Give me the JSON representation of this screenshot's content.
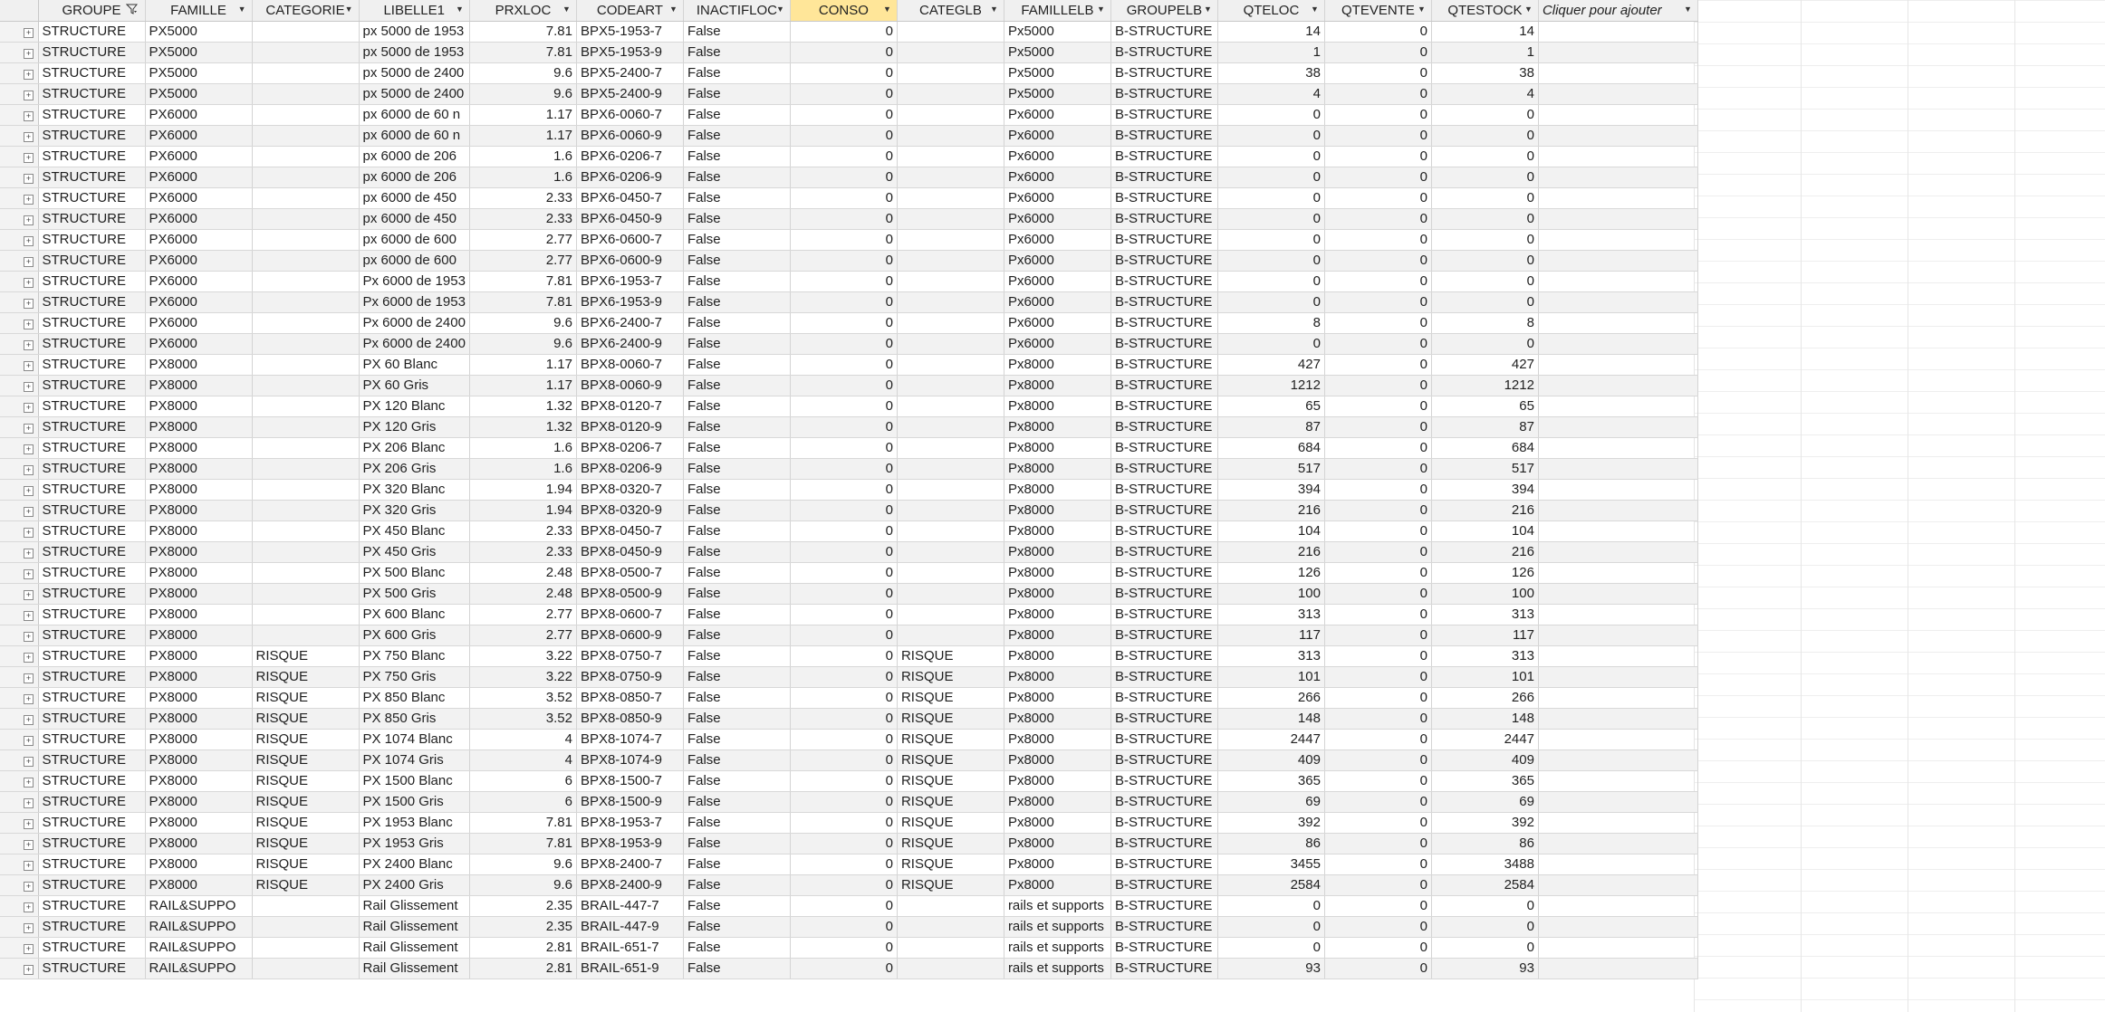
{
  "columns": [
    {
      "key": "GROUPE",
      "label": "GROUPE",
      "icon": "filter-dropdown-icon"
    },
    {
      "key": "FAMILLE",
      "label": "FAMILLE",
      "icon": "dropdown-arrow-icon"
    },
    {
      "key": "CATEGORIE",
      "label": "CATEGORIE",
      "icon": "dropdown-arrow-icon"
    },
    {
      "key": "LIBELLE1",
      "label": "LIBELLE1",
      "icon": "dropdown-arrow-icon"
    },
    {
      "key": "PRXLOC",
      "label": "PRXLOC",
      "icon": "dropdown-arrow-icon"
    },
    {
      "key": "CODEART",
      "label": "CODEART",
      "icon": "dropdown-arrow-icon"
    },
    {
      "key": "INACTIFLOC",
      "label": "INACTIFLOC",
      "icon": "dropdown-arrow-icon"
    },
    {
      "key": "CONSO",
      "label": "CONSO",
      "icon": "dropdown-arrow-icon",
      "active": true
    },
    {
      "key": "CATEGLB",
      "label": "CATEGLB",
      "icon": "dropdown-arrow-icon"
    },
    {
      "key": "FAMILLELB",
      "label": "FAMILLELB",
      "icon": "dropdown-arrow-icon"
    },
    {
      "key": "GROUPELB",
      "label": "GROUPELB",
      "icon": "dropdown-arrow-icon"
    },
    {
      "key": "QTELOC",
      "label": "QTELOC",
      "icon": "dropdown-arrow-icon"
    },
    {
      "key": "QTEVENTE",
      "label": "QTEVENTE",
      "icon": "dropdown-arrow-icon"
    },
    {
      "key": "QTESTOCK",
      "label": "QTESTOCK",
      "icon": "dropdown-arrow-icon"
    },
    {
      "key": "ADD",
      "label": "Cliquer pour ajouter",
      "icon": "dropdown-arrow-icon"
    }
  ],
  "rows": [
    [
      "STRUCTURE",
      "PX5000",
      "",
      "px 5000 de 1953",
      "7.81",
      "BPX5-1953-7",
      "False",
      "0",
      "",
      "Px5000",
      "B-STRUCTURE",
      "14",
      "0",
      "14"
    ],
    [
      "STRUCTURE",
      "PX5000",
      "",
      "px 5000 de 1953",
      "7.81",
      "BPX5-1953-9",
      "False",
      "0",
      "",
      "Px5000",
      "B-STRUCTURE",
      "1",
      "0",
      "1"
    ],
    [
      "STRUCTURE",
      "PX5000",
      "",
      "px 5000 de 2400",
      "9.6",
      "BPX5-2400-7",
      "False",
      "0",
      "",
      "Px5000",
      "B-STRUCTURE",
      "38",
      "0",
      "38"
    ],
    [
      "STRUCTURE",
      "PX5000",
      "",
      "px 5000 de 2400",
      "9.6",
      "BPX5-2400-9",
      "False",
      "0",
      "",
      "Px5000",
      "B-STRUCTURE",
      "4",
      "0",
      "4"
    ],
    [
      "STRUCTURE",
      "PX6000",
      "",
      "px 6000 de 60 n",
      "1.17",
      "BPX6-0060-7",
      "False",
      "0",
      "",
      "Px6000",
      "B-STRUCTURE",
      "0",
      "0",
      "0"
    ],
    [
      "STRUCTURE",
      "PX6000",
      "",
      "px 6000 de 60 n",
      "1.17",
      "BPX6-0060-9",
      "False",
      "0",
      "",
      "Px6000",
      "B-STRUCTURE",
      "0",
      "0",
      "0"
    ],
    [
      "STRUCTURE",
      "PX6000",
      "",
      "px 6000 de 206",
      "1.6",
      "BPX6-0206-7",
      "False",
      "0",
      "",
      "Px6000",
      "B-STRUCTURE",
      "0",
      "0",
      "0"
    ],
    [
      "STRUCTURE",
      "PX6000",
      "",
      "px 6000 de 206",
      "1.6",
      "BPX6-0206-9",
      "False",
      "0",
      "",
      "Px6000",
      "B-STRUCTURE",
      "0",
      "0",
      "0"
    ],
    [
      "STRUCTURE",
      "PX6000",
      "",
      "px 6000 de 450",
      "2.33",
      "BPX6-0450-7",
      "False",
      "0",
      "",
      "Px6000",
      "B-STRUCTURE",
      "0",
      "0",
      "0"
    ],
    [
      "STRUCTURE",
      "PX6000",
      "",
      "px 6000 de 450",
      "2.33",
      "BPX6-0450-9",
      "False",
      "0",
      "",
      "Px6000",
      "B-STRUCTURE",
      "0",
      "0",
      "0"
    ],
    [
      "STRUCTURE",
      "PX6000",
      "",
      "px 6000 de 600",
      "2.77",
      "BPX6-0600-7",
      "False",
      "0",
      "",
      "Px6000",
      "B-STRUCTURE",
      "0",
      "0",
      "0"
    ],
    [
      "STRUCTURE",
      "PX6000",
      "",
      "px 6000 de 600",
      "2.77",
      "BPX6-0600-9",
      "False",
      "0",
      "",
      "Px6000",
      "B-STRUCTURE",
      "0",
      "0",
      "0"
    ],
    [
      "STRUCTURE",
      "PX6000",
      "",
      "Px 6000 de 1953",
      "7.81",
      "BPX6-1953-7",
      "False",
      "0",
      "",
      "Px6000",
      "B-STRUCTURE",
      "0",
      "0",
      "0"
    ],
    [
      "STRUCTURE",
      "PX6000",
      "",
      "Px 6000 de 1953",
      "7.81",
      "BPX6-1953-9",
      "False",
      "0",
      "",
      "Px6000",
      "B-STRUCTURE",
      "0",
      "0",
      "0"
    ],
    [
      "STRUCTURE",
      "PX6000",
      "",
      "Px 6000 de 2400",
      "9.6",
      "BPX6-2400-7",
      "False",
      "0",
      "",
      "Px6000",
      "B-STRUCTURE",
      "8",
      "0",
      "8"
    ],
    [
      "STRUCTURE",
      "PX6000",
      "",
      "Px 6000 de 2400",
      "9.6",
      "BPX6-2400-9",
      "False",
      "0",
      "",
      "Px6000",
      "B-STRUCTURE",
      "0",
      "0",
      "0"
    ],
    [
      "STRUCTURE",
      "PX8000",
      "",
      "PX 60 Blanc",
      "1.17",
      "BPX8-0060-7",
      "False",
      "0",
      "",
      "Px8000",
      "B-STRUCTURE",
      "427",
      "0",
      "427"
    ],
    [
      "STRUCTURE",
      "PX8000",
      "",
      "PX 60 Gris",
      "1.17",
      "BPX8-0060-9",
      "False",
      "0",
      "",
      "Px8000",
      "B-STRUCTURE",
      "1212",
      "0",
      "1212"
    ],
    [
      "STRUCTURE",
      "PX8000",
      "",
      "PX 120 Blanc",
      "1.32",
      "BPX8-0120-7",
      "False",
      "0",
      "",
      "Px8000",
      "B-STRUCTURE",
      "65",
      "0",
      "65"
    ],
    [
      "STRUCTURE",
      "PX8000",
      "",
      "PX 120 Gris",
      "1.32",
      "BPX8-0120-9",
      "False",
      "0",
      "",
      "Px8000",
      "B-STRUCTURE",
      "87",
      "0",
      "87"
    ],
    [
      "STRUCTURE",
      "PX8000",
      "",
      "PX 206 Blanc",
      "1.6",
      "BPX8-0206-7",
      "False",
      "0",
      "",
      "Px8000",
      "B-STRUCTURE",
      "684",
      "0",
      "684"
    ],
    [
      "STRUCTURE",
      "PX8000",
      "",
      "PX 206 Gris",
      "1.6",
      "BPX8-0206-9",
      "False",
      "0",
      "",
      "Px8000",
      "B-STRUCTURE",
      "517",
      "0",
      "517"
    ],
    [
      "STRUCTURE",
      "PX8000",
      "",
      "PX 320 Blanc",
      "1.94",
      "BPX8-0320-7",
      "False",
      "0",
      "",
      "Px8000",
      "B-STRUCTURE",
      "394",
      "0",
      "394"
    ],
    [
      "STRUCTURE",
      "PX8000",
      "",
      "PX 320 Gris",
      "1.94",
      "BPX8-0320-9",
      "False",
      "0",
      "",
      "Px8000",
      "B-STRUCTURE",
      "216",
      "0",
      "216"
    ],
    [
      "STRUCTURE",
      "PX8000",
      "",
      "PX 450 Blanc",
      "2.33",
      "BPX8-0450-7",
      "False",
      "0",
      "",
      "Px8000",
      "B-STRUCTURE",
      "104",
      "0",
      "104"
    ],
    [
      "STRUCTURE",
      "PX8000",
      "",
      "PX 450 Gris",
      "2.33",
      "BPX8-0450-9",
      "False",
      "0",
      "",
      "Px8000",
      "B-STRUCTURE",
      "216",
      "0",
      "216"
    ],
    [
      "STRUCTURE",
      "PX8000",
      "",
      "PX 500 Blanc",
      "2.48",
      "BPX8-0500-7",
      "False",
      "0",
      "",
      "Px8000",
      "B-STRUCTURE",
      "126",
      "0",
      "126"
    ],
    [
      "STRUCTURE",
      "PX8000",
      "",
      "PX 500 Gris",
      "2.48",
      "BPX8-0500-9",
      "False",
      "0",
      "",
      "Px8000",
      "B-STRUCTURE",
      "100",
      "0",
      "100"
    ],
    [
      "STRUCTURE",
      "PX8000",
      "",
      "PX 600 Blanc",
      "2.77",
      "BPX8-0600-7",
      "False",
      "0",
      "",
      "Px8000",
      "B-STRUCTURE",
      "313",
      "0",
      "313"
    ],
    [
      "STRUCTURE",
      "PX8000",
      "",
      "PX 600 Gris",
      "2.77",
      "BPX8-0600-9",
      "False",
      "0",
      "",
      "Px8000",
      "B-STRUCTURE",
      "117",
      "0",
      "117"
    ],
    [
      "STRUCTURE",
      "PX8000",
      "RISQUE",
      "PX 750 Blanc",
      "3.22",
      "BPX8-0750-7",
      "False",
      "0",
      "RISQUE",
      "Px8000",
      "B-STRUCTURE",
      "313",
      "0",
      "313"
    ],
    [
      "STRUCTURE",
      "PX8000",
      "RISQUE",
      "PX 750 Gris",
      "3.22",
      "BPX8-0750-9",
      "False",
      "0",
      "RISQUE",
      "Px8000",
      "B-STRUCTURE",
      "101",
      "0",
      "101"
    ],
    [
      "STRUCTURE",
      "PX8000",
      "RISQUE",
      "PX 850 Blanc",
      "3.52",
      "BPX8-0850-7",
      "False",
      "0",
      "RISQUE",
      "Px8000",
      "B-STRUCTURE",
      "266",
      "0",
      "266"
    ],
    [
      "STRUCTURE",
      "PX8000",
      "RISQUE",
      "PX 850 Gris",
      "3.52",
      "BPX8-0850-9",
      "False",
      "0",
      "RISQUE",
      "Px8000",
      "B-STRUCTURE",
      "148",
      "0",
      "148"
    ],
    [
      "STRUCTURE",
      "PX8000",
      "RISQUE",
      "PX 1074 Blanc",
      "4",
      "BPX8-1074-7",
      "False",
      "0",
      "RISQUE",
      "Px8000",
      "B-STRUCTURE",
      "2447",
      "0",
      "2447"
    ],
    [
      "STRUCTURE",
      "PX8000",
      "RISQUE",
      "PX 1074 Gris",
      "4",
      "BPX8-1074-9",
      "False",
      "0",
      "RISQUE",
      "Px8000",
      "B-STRUCTURE",
      "409",
      "0",
      "409"
    ],
    [
      "STRUCTURE",
      "PX8000",
      "RISQUE",
      "PX 1500 Blanc",
      "6",
      "BPX8-1500-7",
      "False",
      "0",
      "RISQUE",
      "Px8000",
      "B-STRUCTURE",
      "365",
      "0",
      "365"
    ],
    [
      "STRUCTURE",
      "PX8000",
      "RISQUE",
      "PX 1500 Gris",
      "6",
      "BPX8-1500-9",
      "False",
      "0",
      "RISQUE",
      "Px8000",
      "B-STRUCTURE",
      "69",
      "0",
      "69"
    ],
    [
      "STRUCTURE",
      "PX8000",
      "RISQUE",
      "PX 1953 Blanc",
      "7.81",
      "BPX8-1953-7",
      "False",
      "0",
      "RISQUE",
      "Px8000",
      "B-STRUCTURE",
      "392",
      "0",
      "392"
    ],
    [
      "STRUCTURE",
      "PX8000",
      "RISQUE",
      "PX 1953 Gris",
      "7.81",
      "BPX8-1953-9",
      "False",
      "0",
      "RISQUE",
      "Px8000",
      "B-STRUCTURE",
      "86",
      "0",
      "86"
    ],
    [
      "STRUCTURE",
      "PX8000",
      "RISQUE",
      "PX 2400 Blanc",
      "9.6",
      "BPX8-2400-7",
      "False",
      "0",
      "RISQUE",
      "Px8000",
      "B-STRUCTURE",
      "3455",
      "0",
      "3488"
    ],
    [
      "STRUCTURE",
      "PX8000",
      "RISQUE",
      "PX 2400 Gris",
      "9.6",
      "BPX8-2400-9",
      "False",
      "0",
      "RISQUE",
      "Px8000",
      "B-STRUCTURE",
      "2584",
      "0",
      "2584"
    ],
    [
      "STRUCTURE",
      "RAIL&SUPPO",
      "",
      "Rail Glissement",
      "2.35",
      "BRAIL-447-7",
      "False",
      "0",
      "",
      "rails et supports",
      "B-STRUCTURE",
      "0",
      "0",
      "0"
    ],
    [
      "STRUCTURE",
      "RAIL&SUPPO",
      "",
      "Rail Glissement",
      "2.35",
      "BRAIL-447-9",
      "False",
      "0",
      "",
      "rails et supports",
      "B-STRUCTURE",
      "0",
      "0",
      "0"
    ],
    [
      "STRUCTURE",
      "RAIL&SUPPO",
      "",
      "Rail Glissement",
      "2.81",
      "BRAIL-651-7",
      "False",
      "0",
      "",
      "rails et supports",
      "B-STRUCTURE",
      "0",
      "0",
      "0"
    ],
    [
      "STRUCTURE",
      "RAIL&SUPPO",
      "",
      "Rail Glissement",
      "2.81",
      "BRAIL-651-9",
      "False",
      "0",
      "",
      "rails et supports",
      "B-STRUCTURE",
      "93",
      "0",
      "93"
    ]
  ],
  "row_expand_glyph": "+",
  "colors": {
    "active_header": "#ffe699",
    "header": "#f0f0f0",
    "alt_row": "#f2f2f2"
  }
}
